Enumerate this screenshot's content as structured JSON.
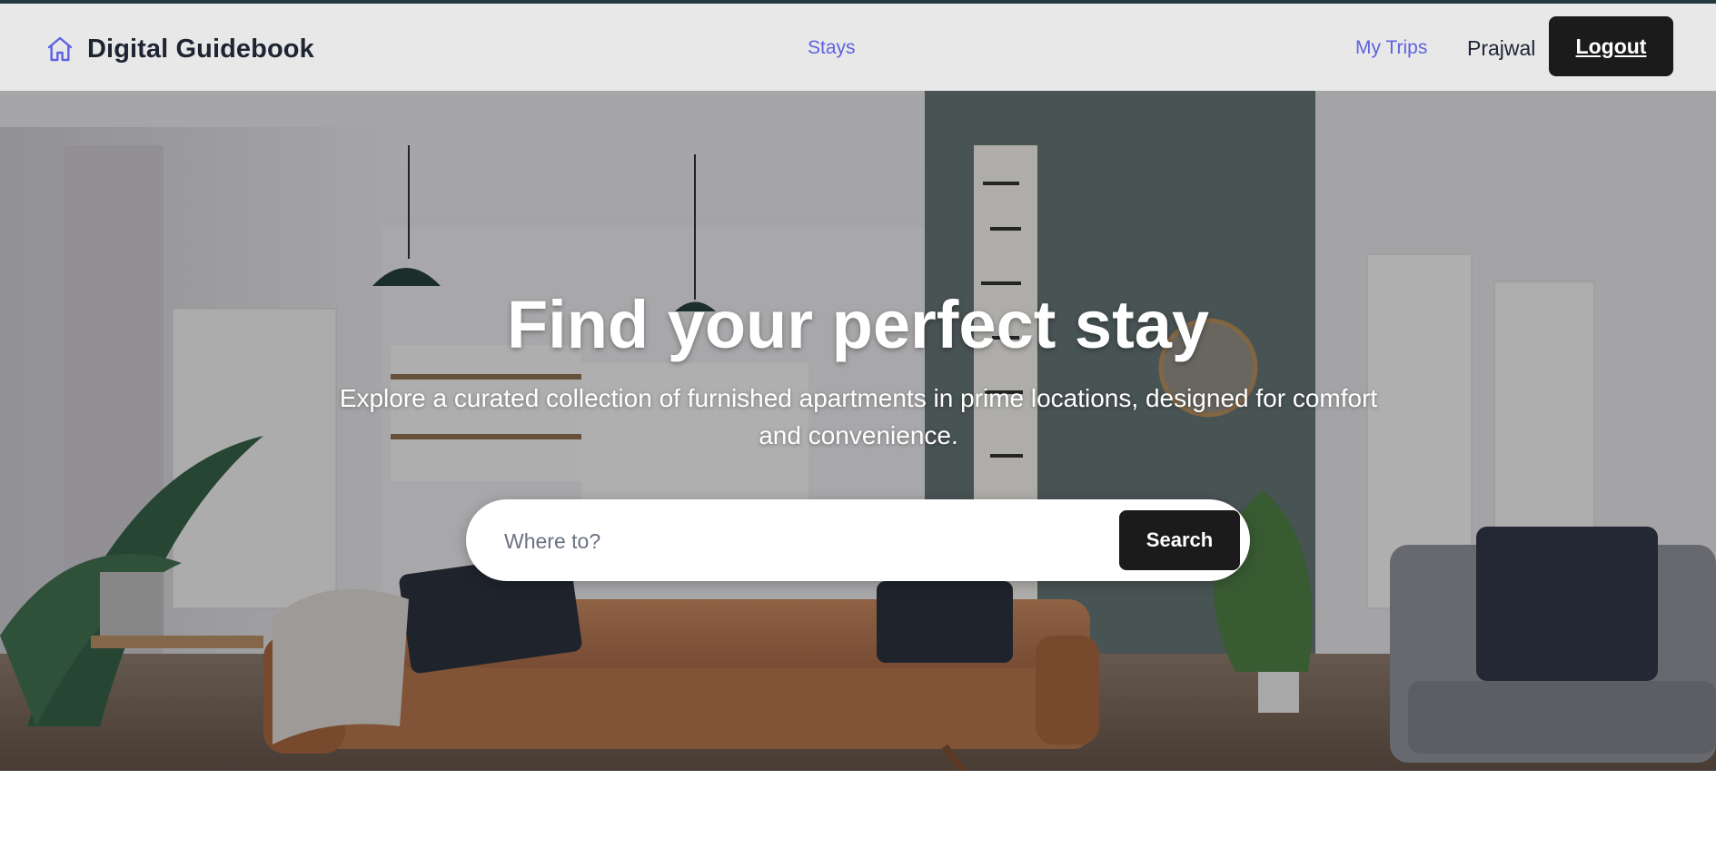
{
  "header": {
    "brand_name": "Digital Guidebook",
    "brand_icon": "home-icon",
    "nav": {
      "stays_label": "Stays",
      "my_trips_label": "My Trips"
    },
    "user_name": "Prajwal",
    "logout_label": "Logout"
  },
  "hero": {
    "title": "Find your perfect stay",
    "subtitle": "Explore a curated collection of furnished apartments in prime locations, designed for comfort and convenience.",
    "search": {
      "placeholder": "Where to?",
      "value": "",
      "button_label": "Search"
    }
  },
  "colors": {
    "accent": "#5e63e0",
    "header_bg": "#e8e8e9",
    "dark_button": "#1b1b1b",
    "top_rule": "#26393f"
  }
}
